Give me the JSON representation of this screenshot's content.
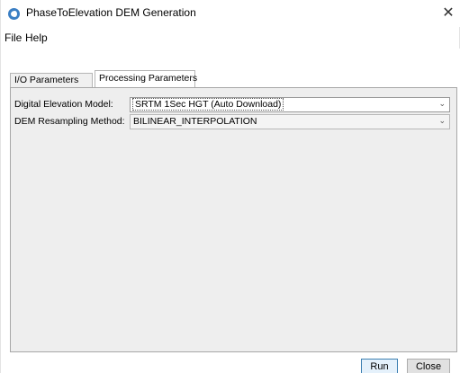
{
  "window": {
    "title": "PhaseToElevation DEM Generation",
    "close_glyph": "✕"
  },
  "menu": {
    "file": "File",
    "help": "Help"
  },
  "tabs": [
    {
      "label": "I/O Parameters",
      "active": false
    },
    {
      "label": "Processing Parameters",
      "active": true
    }
  ],
  "params": {
    "dem_label": "Digital Elevation Model:",
    "dem_value": "SRTM 1Sec HGT (Auto Download)",
    "resampling_label": "DEM Resampling Method:",
    "resampling_value": "BILINEAR_INTERPOLATION"
  },
  "buttons": {
    "run": "Run",
    "close": "Close"
  },
  "icons": {
    "app": "app-logo-icon",
    "dropdown": "chevron-down-icon",
    "close": "close-icon"
  }
}
